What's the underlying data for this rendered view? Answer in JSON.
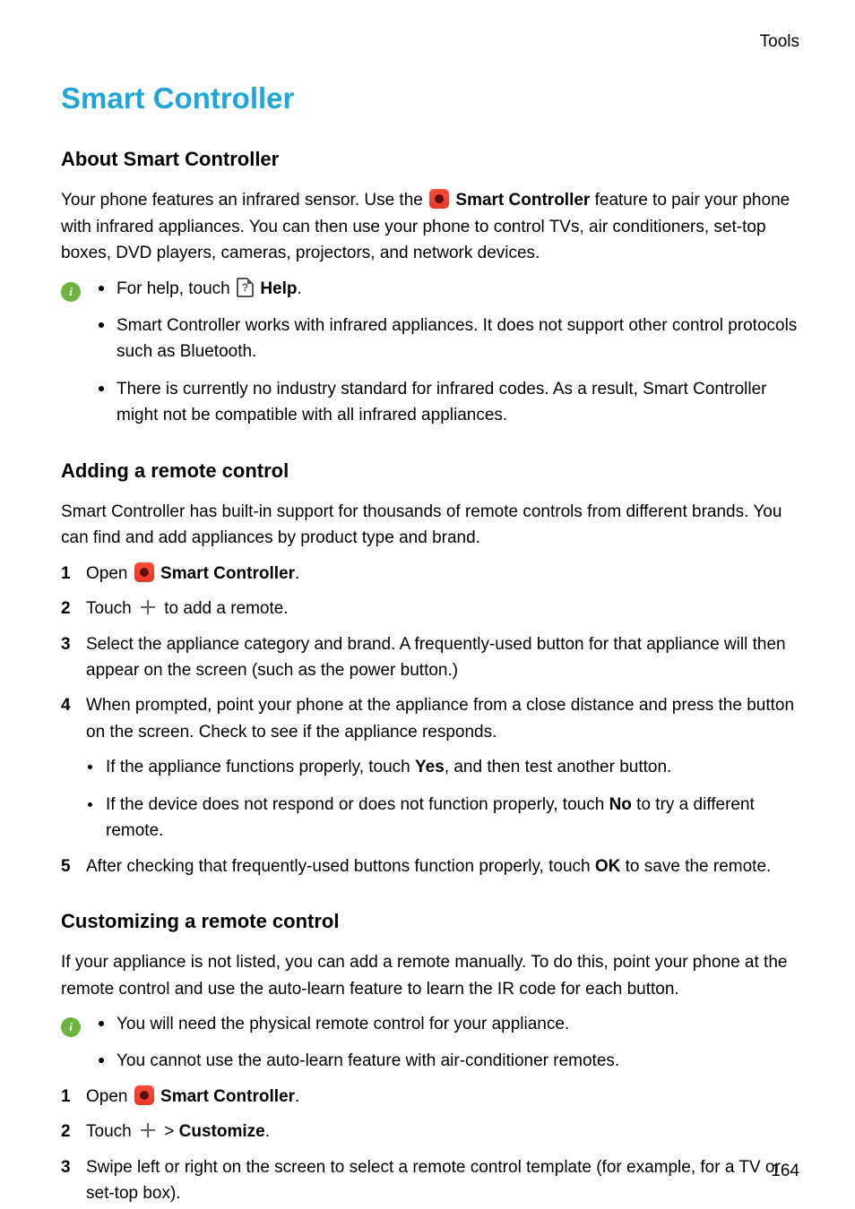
{
  "header_label": "Tools",
  "page_number": "164",
  "main_title": "Smart Controller",
  "section_about": {
    "heading": "About Smart Controller",
    "intro_1a": "Your phone features an infrared sensor. Use the ",
    "intro_1b": "Smart Controller",
    "intro_1c": " feature to pair your phone with infrared appliances. You can then use your phone to control TVs, air conditioners, set-top boxes, DVD players, cameras, projectors, and network devices.",
    "info_bullets": {
      "b1a": "For help, touch ",
      "b1b": "Help",
      "b1c": ".",
      "b2": "Smart Controller works with infrared appliances. It does not support other control protocols such as Bluetooth.",
      "b3": "There is currently no industry standard for infrared codes. As a result, Smart Controller might not be compatible with all infrared appliances."
    }
  },
  "section_adding": {
    "heading": "Adding a remote control",
    "intro": "Smart Controller has built-in support for thousands of remote controls from different brands. You can find and add appliances by product type and brand.",
    "step1_a": "Open ",
    "step1_b": "Smart Controller",
    "step1_c": ".",
    "step2_a": "Touch ",
    "step2_b": " to add a remote.",
    "step3": "Select the appliance category and brand. A frequently-used button for that appliance will then appear on the screen (such as the power button.)",
    "step4": "When prompted, point your phone at the appliance from a close distance and press the button on the screen. Check to see if the appliance responds.",
    "step4_b1a": "If the appliance functions properly, touch ",
    "step4_b1b": "Yes",
    "step4_b1c": ", and then test another button.",
    "step4_b2a": "If the device does not respond or does not function properly, touch ",
    "step4_b2b": "No",
    "step4_b2c": " to try a different remote.",
    "step5_a": "After checking that frequently-used buttons function properly, touch ",
    "step5_b": "OK",
    "step5_c": " to save the remote."
  },
  "section_customizing": {
    "heading": "Customizing a remote control",
    "intro": "If your appliance is not listed, you can add a remote manually. To do this, point your phone at the remote control and use the auto-learn feature to learn the IR code for each button.",
    "info_b1": "You will need the physical remote control for your appliance.",
    "info_b2": "You cannot use the auto-learn feature with air-conditioner remotes.",
    "step1_a": "Open ",
    "step1_b": "Smart Controller",
    "step1_c": ".",
    "step2_a": "Touch ",
    "step2_b": " > ",
    "step2_c": "Customize",
    "step2_d": ".",
    "step3": "Swipe left or right on the screen to select a remote control template (for example, for a TV or set-top box)."
  },
  "nums": {
    "n1": "1",
    "n2": "2",
    "n3": "3",
    "n4": "4",
    "n5": "5"
  }
}
